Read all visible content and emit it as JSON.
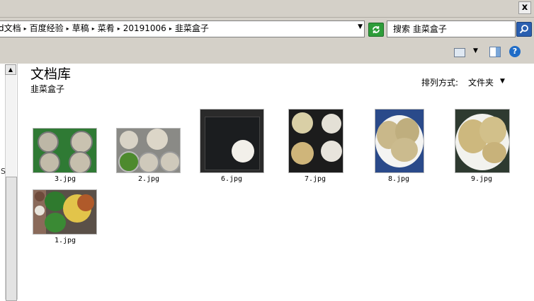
{
  "window": {
    "close_label": "x"
  },
  "address_bar": {
    "crumbs": [
      "d文档",
      "百度经验",
      "草稿",
      "菜肴",
      "20191006",
      "韭菜盒子"
    ],
    "separator": "▸",
    "dropdown": "▼"
  },
  "search": {
    "text": "搜索 韭菜盒子"
  },
  "toolbar": {
    "view_dropdown": "▼",
    "help": "?"
  },
  "library": {
    "title": "文档库",
    "subtitle": "韭菜盒子",
    "sort_label": "排列方式:",
    "sort_value": "文件夹",
    "sort_arrow": "▼"
  },
  "left_pane": {
    "letter": "S",
    "scroll_up": "▲"
  },
  "files": [
    {
      "name": "3.jpg"
    },
    {
      "name": "2.jpg"
    },
    {
      "name": "6.jpg"
    },
    {
      "name": "7.jpg"
    },
    {
      "name": "8.jpg"
    },
    {
      "name": "9.jpg"
    },
    {
      "name": "1.jpg"
    }
  ]
}
